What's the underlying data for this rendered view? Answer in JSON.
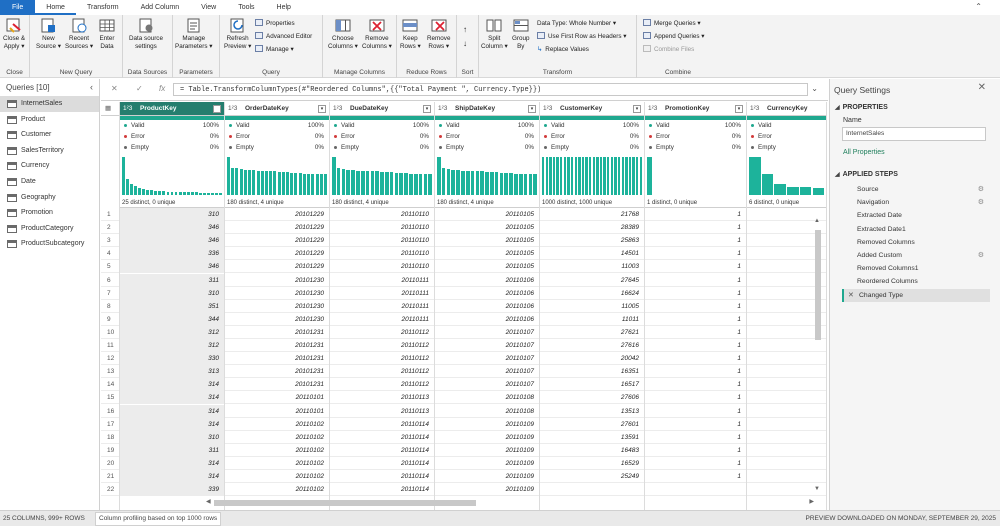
{
  "tabs": [
    "File",
    "Home",
    "Transform",
    "Add Column",
    "View",
    "Tools",
    "Help"
  ],
  "ribbon": {
    "groups": {
      "close": "Close",
      "new_query": "New Query",
      "data_sources": "Data Sources",
      "parameters": "Parameters",
      "query": "Query",
      "manage_columns": "Manage Columns",
      "reduce_rows": "Reduce Rows",
      "sort": "Sort",
      "transform": "Transform",
      "combine": "Combine"
    },
    "close_apply": [
      "Close &",
      "Apply ▾"
    ],
    "new_source": [
      "New",
      "Source ▾"
    ],
    "recent_sources": [
      "Recent",
      "Sources ▾"
    ],
    "enter_data": [
      "Enter",
      "Data"
    ],
    "data_source_settings": [
      "Data source",
      "settings"
    ],
    "manage_parameters": [
      "Manage",
      "Parameters ▾"
    ],
    "refresh_preview": [
      "Refresh",
      "Preview ▾"
    ],
    "properties": "Properties",
    "advanced_editor": "Advanced Editor",
    "manage": "Manage ▾",
    "choose_columns": [
      "Choose",
      "Columns ▾"
    ],
    "remove_columns": [
      "Remove",
      "Columns ▾"
    ],
    "keep_rows": [
      "Keep",
      "Rows ▾"
    ],
    "remove_rows": [
      "Remove",
      "Rows ▾"
    ],
    "split_column": [
      "Split",
      "Column ▾"
    ],
    "group_by": [
      "Group",
      "By"
    ],
    "data_type": "Data Type: Whole Number ▾",
    "first_row_headers": "Use First Row as Headers ▾",
    "replace_values": "Replace Values",
    "merge_queries": "Merge Queries ▾",
    "append_queries": "Append Queries ▾",
    "combine_files": "Combine Files"
  },
  "queries": {
    "header": "Queries [10]",
    "items": [
      "InternetSales",
      "Product",
      "Customer",
      "SalesTerritory",
      "Currency",
      "Date",
      "Geography",
      "Promotion",
      "ProductCategory",
      "ProductSubcategory"
    ]
  },
  "formula": "= Table.TransformColumnTypes(#\"Reordered Columns\",{{\"Total Payment \", Currency.Type}})",
  "columns": [
    {
      "type": "1²3",
      "name": "ProductKey",
      "valid": "100%",
      "error": "0%",
      "empty": "0%",
      "distinct": "25 distinct, 0 unique",
      "values": [
        "310",
        "346",
        "346",
        "336",
        "346",
        "311",
        "310",
        "351",
        "344",
        "312",
        "312",
        "330",
        "313",
        "314",
        "314",
        "314",
        "314",
        "310",
        "311",
        "314",
        "314",
        "339"
      ]
    },
    {
      "type": "1²3",
      "name": "OrderDateKey",
      "valid": "100%",
      "error": "0%",
      "empty": "0%",
      "distinct": "180 distinct, 4 unique",
      "values": [
        "20101229",
        "20101229",
        "20101229",
        "20101229",
        "20101229",
        "20101230",
        "20101230",
        "20101230",
        "20101230",
        "20101231",
        "20101231",
        "20101231",
        "20101231",
        "20101231",
        "20110101",
        "20110101",
        "20110102",
        "20110102",
        "20110102",
        "20110102",
        "20110102",
        "20110102"
      ]
    },
    {
      "type": "1²3",
      "name": "DueDateKey",
      "valid": "100%",
      "error": "0%",
      "empty": "0%",
      "distinct": "180 distinct, 4 unique",
      "values": [
        "20110110",
        "20110110",
        "20110110",
        "20110110",
        "20110110",
        "20110111",
        "20110111",
        "20110111",
        "20110111",
        "20110112",
        "20110112",
        "20110112",
        "20110112",
        "20110112",
        "20110113",
        "20110113",
        "20110114",
        "20110114",
        "20110114",
        "20110114",
        "20110114",
        "20110114"
      ]
    },
    {
      "type": "1²3",
      "name": "ShipDateKey",
      "valid": "100%",
      "error": "0%",
      "empty": "0%",
      "distinct": "180 distinct, 4 unique",
      "values": [
        "20110105",
        "20110105",
        "20110105",
        "20110105",
        "20110105",
        "20110106",
        "20110106",
        "20110106",
        "20110106",
        "20110107",
        "20110107",
        "20110107",
        "20110107",
        "20110107",
        "20110108",
        "20110108",
        "20110109",
        "20110109",
        "20110109",
        "20110109",
        "20110109",
        "20110109"
      ]
    },
    {
      "type": "1²3",
      "name": "CustomerKey",
      "valid": "100%",
      "error": "0%",
      "empty": "0%",
      "distinct": "1000 distinct, 1000 unique",
      "values": [
        "21768",
        "28389",
        "25863",
        "14501",
        "11003",
        "27645",
        "16624",
        "11005",
        "11011",
        "27621",
        "27616",
        "20042",
        "16351",
        "16517",
        "27606",
        "13513",
        "27601",
        "13591",
        "16483",
        "16529",
        "25249",
        ""
      ]
    },
    {
      "type": "1²3",
      "name": "PromotionKey",
      "valid": "100%",
      "error": "0%",
      "empty": "0%",
      "distinct": "1 distinct, 0 unique",
      "values": [
        "1",
        "1",
        "1",
        "1",
        "1",
        "1",
        "1",
        "1",
        "1",
        "1",
        "1",
        "1",
        "1",
        "1",
        "1",
        "1",
        "1",
        "1",
        "1",
        "1",
        "1",
        ""
      ]
    },
    {
      "type": "1²3",
      "name": "CurrencyKey",
      "valid": "100%",
      "error": "0%",
      "empty": "0%",
      "distinct": "6 distinct, 0 unique",
      "values": [
        "",
        "",
        "",
        "",
        "",
        "",
        "",
        "",
        "",
        "",
        "",
        "",
        "",
        "",
        "",
        "",
        "",
        "",
        "",
        "",
        "",
        ""
      ]
    }
  ],
  "profile_labels": {
    "valid": "Valid",
    "error": "Error",
    "empty": "Empty"
  },
  "histograms": [
    [
      1.0,
      0.42,
      0.3,
      0.24,
      0.18,
      0.15,
      0.13,
      0.12,
      0.11,
      0.1,
      0.1,
      0.09,
      0.09,
      0.08,
      0.08,
      0.08,
      0.07,
      0.07,
      0.07,
      0.06,
      0.06,
      0.06,
      0.05,
      0.05,
      0.05
    ],
    [
      1.0,
      0.72,
      0.7,
      0.68,
      0.66,
      0.66,
      0.65,
      0.64,
      0.64,
      0.63,
      0.62,
      0.62,
      0.6,
      0.6,
      0.6,
      0.58,
      0.58,
      0.58,
      0.56,
      0.56,
      0.56,
      0.56,
      0.55,
      0.55
    ],
    [
      1.0,
      0.7,
      0.68,
      0.66,
      0.66,
      0.64,
      0.64,
      0.63,
      0.62,
      0.62,
      0.6,
      0.6,
      0.6,
      0.58,
      0.58,
      0.58,
      0.56,
      0.56,
      0.56,
      0.55,
      0.55
    ],
    [
      1.0,
      0.7,
      0.68,
      0.66,
      0.66,
      0.64,
      0.64,
      0.63,
      0.62,
      0.62,
      0.6,
      0.6,
      0.6,
      0.58,
      0.58,
      0.58,
      0.56,
      0.56,
      0.56,
      0.55,
      0.55
    ],
    [
      1.0,
      1.0,
      1.0,
      1.0,
      1.0,
      1.0,
      1.0,
      1.0,
      1.0,
      1.0,
      1.0,
      1.0,
      1.0,
      1.0,
      1.0,
      1.0,
      1.0,
      1.0,
      1.0,
      1.0,
      1.0,
      1.0,
      1.0,
      1.0,
      1.0,
      1.0,
      1.0,
      1.0
    ],
    [
      1.0
    ],
    [
      1.0,
      0.55,
      0.3,
      0.22,
      0.2,
      0.18
    ]
  ],
  "row_numbers": [
    "1",
    "2",
    "3",
    "4",
    "5",
    "6",
    "7",
    "8",
    "9",
    "10",
    "11",
    "12",
    "13",
    "14",
    "15",
    "16",
    "17",
    "18",
    "19",
    "20",
    "21",
    "22"
  ],
  "settings": {
    "title": "Query Settings",
    "properties": "PROPERTIES",
    "name_label": "Name",
    "name_value": "InternetSales",
    "all_properties": "All Properties",
    "applied_steps": "APPLIED STEPS",
    "steps": [
      "Source",
      "Navigation",
      "Extracted Date",
      "Extracted Date1",
      "Removed Columns",
      "Added Custom",
      "Removed Columns1",
      "Reordered Columns",
      "Changed Type"
    ]
  },
  "status": {
    "columns_rows": "25 COLUMNS, 999+ ROWS",
    "profiling": "Column profiling based on top 1000 rows",
    "preview": "PREVIEW DOWNLOADED ON MONDAY, SEPTEMBER 29, 2025"
  },
  "colors": {
    "accent": "#1f6fc5",
    "quality": "#1fa88f",
    "histogram": "#1db39b",
    "selected_header": "#257e6e"
  }
}
